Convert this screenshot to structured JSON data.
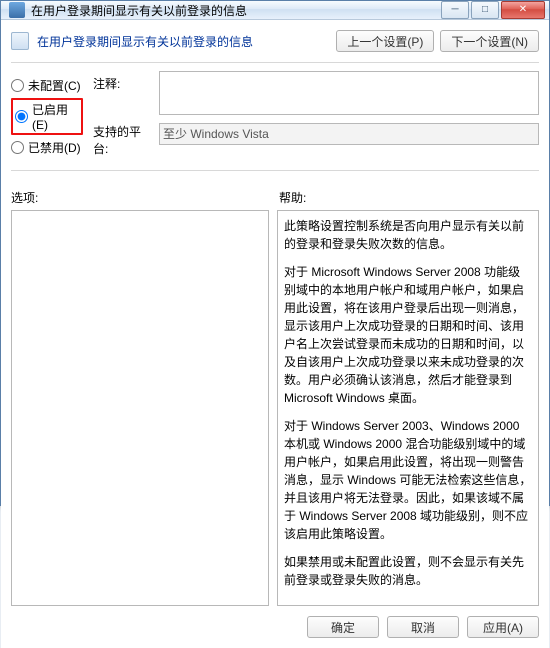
{
  "window": {
    "title": "在用户登录期间显示有关以前登录的信息"
  },
  "header": {
    "title": "在用户登录期间显示有关以前登录的信息",
    "prev": "上一个设置(P)",
    "next": "下一个设置(N)"
  },
  "radios": {
    "not_configured": "未配置(C)",
    "enabled": "已启用(E)",
    "disabled": "已禁用(D)",
    "selected": "enabled"
  },
  "labels": {
    "comment": "注释:",
    "platform": "支持的平台:",
    "options": "选项:",
    "help": "帮助:"
  },
  "fields": {
    "comment": "",
    "platform": "至少 Windows Vista"
  },
  "help_paragraphs": [
    "此策略设置控制系统是否向用户显示有关以前的登录和登录失败次数的信息。",
    "对于 Microsoft Windows Server 2008 功能级别域中的本地用户帐户和域用户帐户，如果启用此设置，将在该用户登录后出现一则消息，显示该用户上次成功登录的日期和时间、该用户名上次尝试登录而未成功的日期和时间，以及自该用户上次成功登录以来未成功登录的次数。用户必须确认该消息，然后才能登录到 Microsoft Windows 桌面。",
    "对于 Windows Server 2003、Windows 2000 本机或 Windows 2000 混合功能级别域中的域用户帐户，如果启用此设置，将出现一则警告消息，显示 Windows 可能无法检索这些信息，并且该用户将无法登录。因此，如果该域不属于 Windows Server 2008 域功能级别，则不应该启用此策略设置。",
    "如果禁用或未配置此设置，则不会显示有关先前登录或登录失败的消息。"
  ],
  "buttons": {
    "ok": "确定",
    "cancel": "取消",
    "apply": "应用(A)"
  }
}
